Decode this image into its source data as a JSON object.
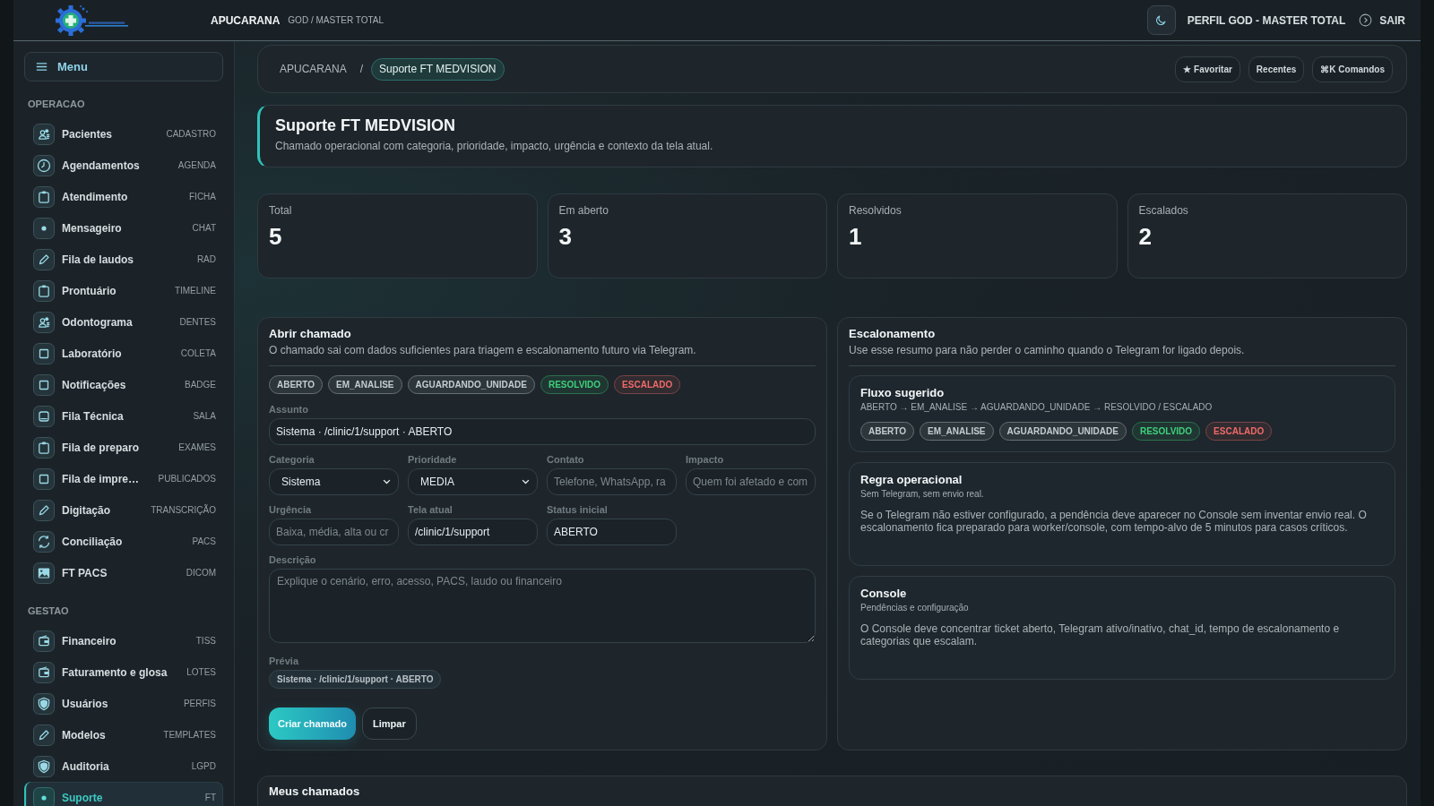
{
  "topbar": {
    "clinic": "APUCARANA",
    "role": "GOD / MASTER TOTAL",
    "profile": "PERFIL GOD - MASTER TOTAL",
    "logout": "SAIR"
  },
  "sidebar": {
    "menu_label": "Menu",
    "sections": [
      {
        "title": "OPERACAO",
        "items": [
          {
            "label": "Pacientes",
            "tag": "CADASTRO",
            "selected": false
          },
          {
            "label": "Agendamentos",
            "tag": "AGENDA",
            "selected": false
          },
          {
            "label": "Atendimento",
            "tag": "FICHA",
            "selected": false
          },
          {
            "label": "Mensageiro",
            "tag": "CHAT",
            "selected": false
          },
          {
            "label": "Fila de laudos",
            "tag": "RAD",
            "selected": false
          },
          {
            "label": "Prontuário",
            "tag": "TIMELINE",
            "selected": false
          },
          {
            "label": "Odontograma",
            "tag": "DENTES",
            "selected": false
          },
          {
            "label": "Laboratório",
            "tag": "COLETA",
            "selected": false
          },
          {
            "label": "Notificações",
            "tag": "BADGE",
            "selected": false
          },
          {
            "label": "Fila Técnica",
            "tag": "SALA",
            "selected": false
          },
          {
            "label": "Fila de preparo",
            "tag": "EXAMES",
            "selected": false
          },
          {
            "label": "Fila de impre…",
            "tag": "PUBLICADOS",
            "selected": false
          },
          {
            "label": "Digitação",
            "tag": "TRANSCRIÇÃO",
            "selected": false
          },
          {
            "label": "Conciliação",
            "tag": "PACS",
            "selected": false
          },
          {
            "label": "FT PACS",
            "tag": "DICOM",
            "selected": false
          }
        ]
      },
      {
        "title": "GESTAO",
        "items": [
          {
            "label": "Financeiro",
            "tag": "TISS",
            "selected": false
          },
          {
            "label": "Faturamento e glosa",
            "tag": "LOTES",
            "selected": false
          },
          {
            "label": "Usuários",
            "tag": "PERFIS",
            "selected": false
          },
          {
            "label": "Modelos",
            "tag": "TEMPLATES",
            "selected": false
          },
          {
            "label": "Auditoria",
            "tag": "LGPD",
            "selected": false
          },
          {
            "label": "Suporte",
            "tag": "FT",
            "selected": true
          }
        ]
      }
    ]
  },
  "breadcrumb": {
    "items": [
      {
        "label": "APUCARANA",
        "selected": false
      },
      {
        "label": "Suporte FT MEDVISION",
        "selected": true
      }
    ],
    "separator": "/",
    "actions": [
      "★ Favoritar",
      "Recentes",
      "⌘K Comandos"
    ]
  },
  "page_header": {
    "title": "Suporte FT MEDVISION",
    "subtitle": "Chamado operacional com categoria, prioridade, impacto, urgência e contexto da tela atual."
  },
  "stats": [
    {
      "label": "Total",
      "value": "5"
    },
    {
      "label": "Em aberto",
      "value": "3"
    },
    {
      "label": "Resolvidos",
      "value": "1"
    },
    {
      "label": "Escalados",
      "value": "2"
    }
  ],
  "open_ticket": {
    "title": "Abrir chamado",
    "subtitle": "O chamado sai com dados suficientes para triagem e escalonamento futuro via Telegram.",
    "statuses": [
      {
        "label": "ABERTO",
        "color": "#c3ccd1"
      },
      {
        "label": "EM_ANALISE",
        "color": "#c3ccd1"
      },
      {
        "label": "AGUARDANDO_UNIDADE",
        "color": "#c3ccd1"
      },
      {
        "label": "RESOLVIDO",
        "color": "#3fcf7c"
      },
      {
        "label": "ESCALADO",
        "color": "#ef6a6a"
      }
    ],
    "field_rows": [
      {
        "fields": [
          {
            "label": "Assunto",
            "kind": "input",
            "value": "Sistema · /clinic/1/support · ABERTO"
          }
        ]
      },
      {
        "fields": [
          {
            "label": "Categoria",
            "kind": "select",
            "value": "Sistema"
          },
          {
            "label": "Prioridade",
            "kind": "select",
            "value": "MEDIA"
          },
          {
            "label": "Contato",
            "kind": "input",
            "placeholder": "Telefone, WhatsApp, ra"
          },
          {
            "label": "Impacto",
            "kind": "input",
            "placeholder": "Quem foi afetado e com"
          }
        ]
      },
      {
        "fields": [
          {
            "label": "Urgência",
            "kind": "input",
            "placeholder": "Baixa, média, alta ou cr"
          },
          {
            "label": "Tela atual",
            "kind": "input",
            "value": "/clinic/1/support"
          },
          {
            "label": "Status inicial",
            "kind": "input",
            "value": "ABERTO"
          }
        ]
      },
      {
        "fields": [
          {
            "label": "Descrição",
            "kind": "textarea",
            "placeholder": "Explique o cenário, erro, acesso, PACS, laudo ou financeiro"
          }
        ]
      }
    ],
    "preview": {
      "label": "Prévia",
      "value": "Sistema · /clinic/1/support · ABERTO"
    },
    "buttons": [
      {
        "label": "Criar chamado",
        "kind": "primary"
      },
      {
        "label": "Limpar",
        "kind": "secondary"
      }
    ]
  },
  "escalation": {
    "title": "Escalonamento",
    "subtitle": "Use esse resumo para não perder o caminho quando o Telegram for ligado depois.",
    "cards": [
      {
        "kind": "flow",
        "title": "Fluxo sugerido",
        "flow": "ABERTO → EM_ANALISE → AGUARDANDO_UNIDADE → RESOLVIDO / ESCALADO",
        "statuses": [
          {
            "label": "ABERTO",
            "color": "#c3ccd1"
          },
          {
            "label": "EM_ANALISE",
            "color": "#c3ccd1"
          },
          {
            "label": "AGUARDANDO_UNIDADE",
            "color": "#c3ccd1"
          },
          {
            "label": "RESOLVIDO",
            "color": "#3fcf7c"
          },
          {
            "label": "ESCALADO",
            "color": "#ef6a6a"
          }
        ]
      },
      {
        "kind": "note",
        "title": "Regra operacional",
        "subtitle": "Sem Telegram, sem envio real.",
        "body": "Se o Telegram não estiver configurado, a pendência deve aparecer no Console sem inventar envio real. O escalonamento fica preparado para worker/console, com tempo-alvo de 5 minutos para casos críticos."
      },
      {
        "kind": "note",
        "title": "Console",
        "subtitle": "Pendências e configuração",
        "body": "O Console deve concentrar ticket aberto, Telegram ativo/inativo, chat_id, tempo de escalonamento e categorias que escalam."
      }
    ]
  },
  "my_tickets": {
    "title": "Meus chamados"
  }
}
